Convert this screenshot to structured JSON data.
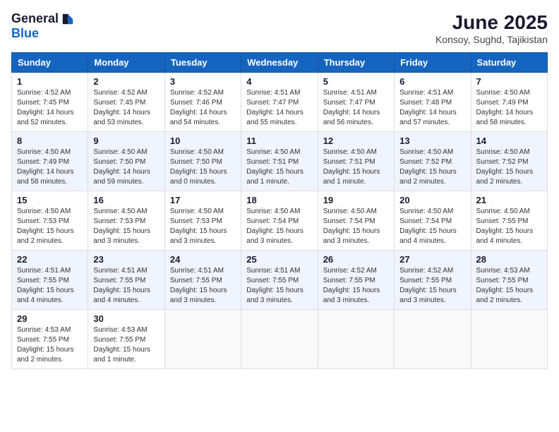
{
  "logo": {
    "general": "General",
    "blue": "Blue"
  },
  "title": {
    "month_year": "June 2025",
    "location": "Konsoy, Sughd, Tajikistan"
  },
  "headers": [
    "Sunday",
    "Monday",
    "Tuesday",
    "Wednesday",
    "Thursday",
    "Friday",
    "Saturday"
  ],
  "weeks": [
    [
      {
        "day": "1",
        "sunrise": "Sunrise: 4:52 AM",
        "sunset": "Sunset: 7:45 PM",
        "daylight": "Daylight: 14 hours and 52 minutes."
      },
      {
        "day": "2",
        "sunrise": "Sunrise: 4:52 AM",
        "sunset": "Sunset: 7:45 PM",
        "daylight": "Daylight: 14 hours and 53 minutes."
      },
      {
        "day": "3",
        "sunrise": "Sunrise: 4:52 AM",
        "sunset": "Sunset: 7:46 PM",
        "daylight": "Daylight: 14 hours and 54 minutes."
      },
      {
        "day": "4",
        "sunrise": "Sunrise: 4:51 AM",
        "sunset": "Sunset: 7:47 PM",
        "daylight": "Daylight: 14 hours and 55 minutes."
      },
      {
        "day": "5",
        "sunrise": "Sunrise: 4:51 AM",
        "sunset": "Sunset: 7:47 PM",
        "daylight": "Daylight: 14 hours and 56 minutes."
      },
      {
        "day": "6",
        "sunrise": "Sunrise: 4:51 AM",
        "sunset": "Sunset: 7:48 PM",
        "daylight": "Daylight: 14 hours and 57 minutes."
      },
      {
        "day": "7",
        "sunrise": "Sunrise: 4:50 AM",
        "sunset": "Sunset: 7:49 PM",
        "daylight": "Daylight: 14 hours and 58 minutes."
      }
    ],
    [
      {
        "day": "8",
        "sunrise": "Sunrise: 4:50 AM",
        "sunset": "Sunset: 7:49 PM",
        "daylight": "Daylight: 14 hours and 58 minutes."
      },
      {
        "day": "9",
        "sunrise": "Sunrise: 4:50 AM",
        "sunset": "Sunset: 7:50 PM",
        "daylight": "Daylight: 14 hours and 59 minutes."
      },
      {
        "day": "10",
        "sunrise": "Sunrise: 4:50 AM",
        "sunset": "Sunset: 7:50 PM",
        "daylight": "Daylight: 15 hours and 0 minutes."
      },
      {
        "day": "11",
        "sunrise": "Sunrise: 4:50 AM",
        "sunset": "Sunset: 7:51 PM",
        "daylight": "Daylight: 15 hours and 1 minute."
      },
      {
        "day": "12",
        "sunrise": "Sunrise: 4:50 AM",
        "sunset": "Sunset: 7:51 PM",
        "daylight": "Daylight: 15 hours and 1 minute."
      },
      {
        "day": "13",
        "sunrise": "Sunrise: 4:50 AM",
        "sunset": "Sunset: 7:52 PM",
        "daylight": "Daylight: 15 hours and 2 minutes."
      },
      {
        "day": "14",
        "sunrise": "Sunrise: 4:50 AM",
        "sunset": "Sunset: 7:52 PM",
        "daylight": "Daylight: 15 hours and 2 minutes."
      }
    ],
    [
      {
        "day": "15",
        "sunrise": "Sunrise: 4:50 AM",
        "sunset": "Sunset: 7:53 PM",
        "daylight": "Daylight: 15 hours and 2 minutes."
      },
      {
        "day": "16",
        "sunrise": "Sunrise: 4:50 AM",
        "sunset": "Sunset: 7:53 PM",
        "daylight": "Daylight: 15 hours and 3 minutes."
      },
      {
        "day": "17",
        "sunrise": "Sunrise: 4:50 AM",
        "sunset": "Sunset: 7:53 PM",
        "daylight": "Daylight: 15 hours and 3 minutes."
      },
      {
        "day": "18",
        "sunrise": "Sunrise: 4:50 AM",
        "sunset": "Sunset: 7:54 PM",
        "daylight": "Daylight: 15 hours and 3 minutes."
      },
      {
        "day": "19",
        "sunrise": "Sunrise: 4:50 AM",
        "sunset": "Sunset: 7:54 PM",
        "daylight": "Daylight: 15 hours and 3 minutes."
      },
      {
        "day": "20",
        "sunrise": "Sunrise: 4:50 AM",
        "sunset": "Sunset: 7:54 PM",
        "daylight": "Daylight: 15 hours and 4 minutes."
      },
      {
        "day": "21",
        "sunrise": "Sunrise: 4:50 AM",
        "sunset": "Sunset: 7:55 PM",
        "daylight": "Daylight: 15 hours and 4 minutes."
      }
    ],
    [
      {
        "day": "22",
        "sunrise": "Sunrise: 4:51 AM",
        "sunset": "Sunset: 7:55 PM",
        "daylight": "Daylight: 15 hours and 4 minutes."
      },
      {
        "day": "23",
        "sunrise": "Sunrise: 4:51 AM",
        "sunset": "Sunset: 7:55 PM",
        "daylight": "Daylight: 15 hours and 4 minutes."
      },
      {
        "day": "24",
        "sunrise": "Sunrise: 4:51 AM",
        "sunset": "Sunset: 7:55 PM",
        "daylight": "Daylight: 15 hours and 3 minutes."
      },
      {
        "day": "25",
        "sunrise": "Sunrise: 4:51 AM",
        "sunset": "Sunset: 7:55 PM",
        "daylight": "Daylight: 15 hours and 3 minutes."
      },
      {
        "day": "26",
        "sunrise": "Sunrise: 4:52 AM",
        "sunset": "Sunset: 7:55 PM",
        "daylight": "Daylight: 15 hours and 3 minutes."
      },
      {
        "day": "27",
        "sunrise": "Sunrise: 4:52 AM",
        "sunset": "Sunset: 7:55 PM",
        "daylight": "Daylight: 15 hours and 3 minutes."
      },
      {
        "day": "28",
        "sunrise": "Sunrise: 4:53 AM",
        "sunset": "Sunset: 7:55 PM",
        "daylight": "Daylight: 15 hours and 2 minutes."
      }
    ],
    [
      {
        "day": "29",
        "sunrise": "Sunrise: 4:53 AM",
        "sunset": "Sunset: 7:55 PM",
        "daylight": "Daylight: 15 hours and 2 minutes."
      },
      {
        "day": "30",
        "sunrise": "Sunrise: 4:53 AM",
        "sunset": "Sunset: 7:55 PM",
        "daylight": "Daylight: 15 hours and 1 minute."
      },
      null,
      null,
      null,
      null,
      null
    ]
  ]
}
